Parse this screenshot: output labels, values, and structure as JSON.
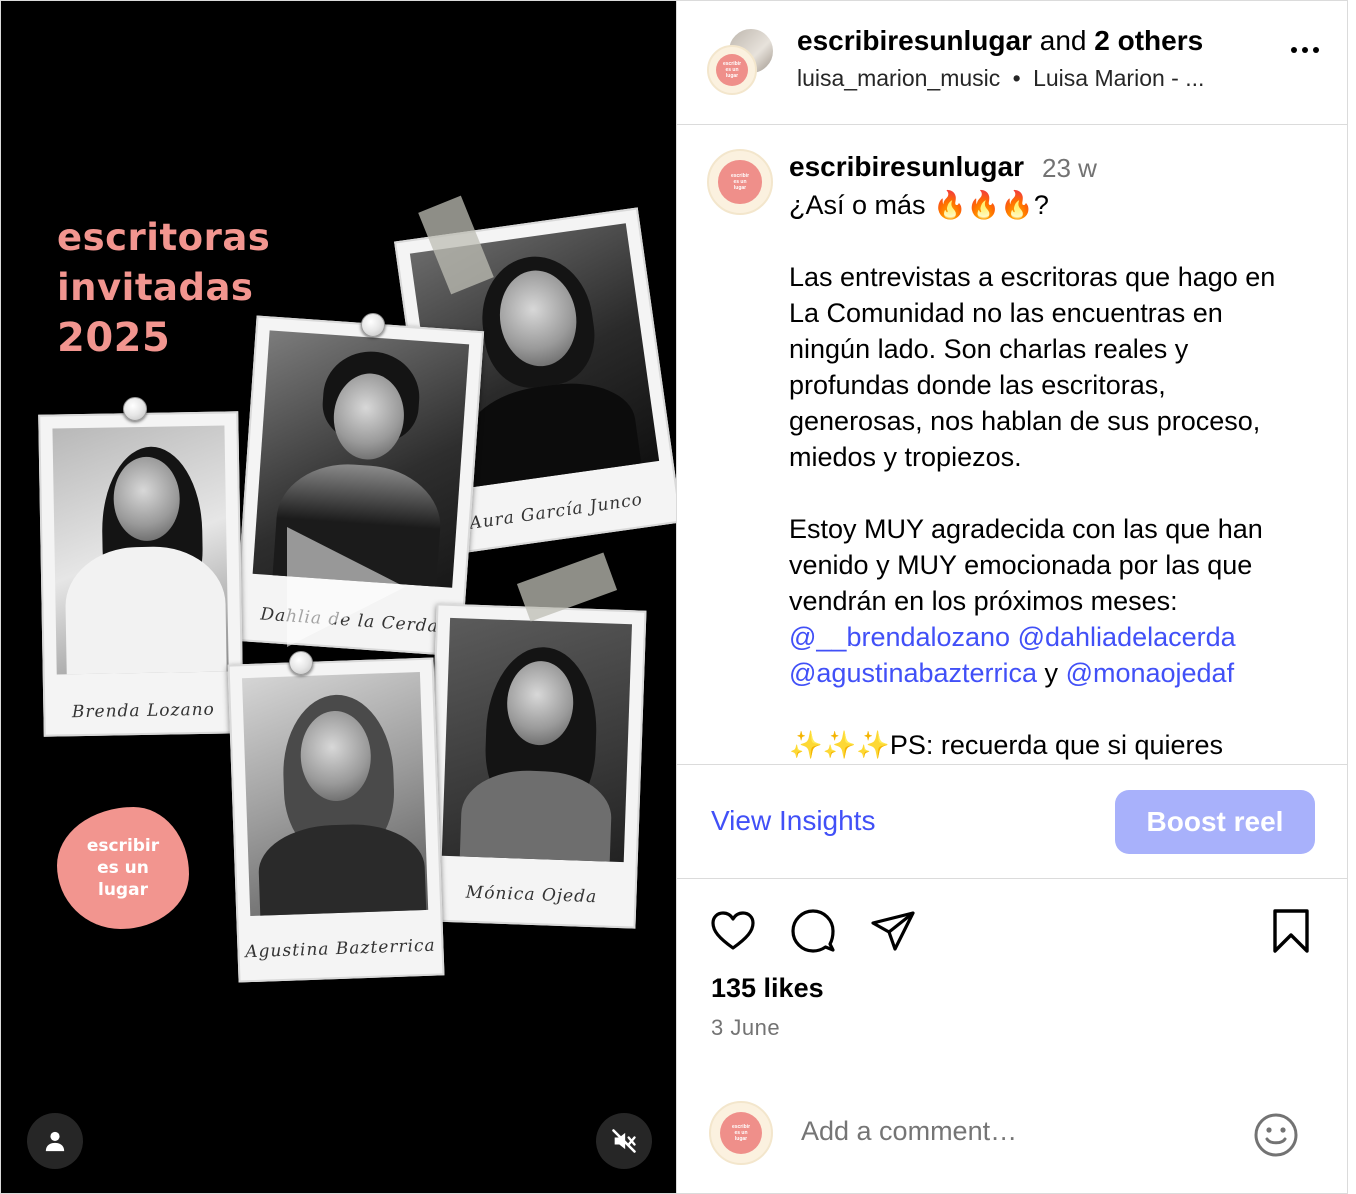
{
  "poster": {
    "title_line1": "escritoras",
    "title_line2": "invitadas",
    "year": "2025",
    "logo_text": "escribir\nes un\nlugar",
    "photos": [
      {
        "caption": "Brenda Lozano"
      },
      {
        "caption": "Dahlia de la Cerda"
      },
      {
        "caption": "Aura García Junco"
      },
      {
        "caption": "Agustina Bazterrica"
      },
      {
        "caption": "Mónica Ojeda"
      }
    ]
  },
  "media_controls": {
    "tagged_icon": "user-icon",
    "mute_icon": "muted-speaker-icon",
    "play_icon": "play-icon"
  },
  "header": {
    "author": "escribiresunlugar",
    "and_text": " and ",
    "others": "2 others",
    "audio_user": "luisa_marion_music",
    "separator": "•",
    "audio_title": "Luisa Marion - ...",
    "more_icon": "more-horizontal-icon",
    "avatar_logo_text": "escribir\nes un\nlugar"
  },
  "caption": {
    "username": "escribiresunlugar",
    "time": "23 w",
    "line1": "¿Así o más 🔥🔥🔥?",
    "para1": [
      "Las entrevistas a escritoras que hago en",
      "La Comunidad no las encuentras en",
      "ningún lado. Son charlas reales y",
      "profundas donde las escritoras,",
      "generosas, nos hablan de sus proceso,",
      "miedos y tropiezos."
    ],
    "para2": [
      "Estoy MUY agradecida con las que han",
      "venido y MUY emocionada por las que",
      "vendrán en los próximos meses:"
    ],
    "mention1": "@__brendalozano",
    "mention2": "@dahliadelacerda",
    "mention3": "@agustinabazterrica",
    "conj": " y ",
    "mention4": "@monaojedaf",
    "ps_line": "✨✨✨PS: recuerda que si quieres"
  },
  "actions": {
    "insights_label": "View Insights",
    "boost_label": "Boost reel"
  },
  "icons": {
    "like": "heart-icon",
    "comment": "comment-icon",
    "share": "send-icon",
    "save": "bookmark-icon",
    "emoji": "emoji-icon"
  },
  "likes": "135 likes",
  "date": "3 June",
  "comment": {
    "placeholder": "Add a comment…"
  },
  "colors": {
    "accent_pink": "#f2958f",
    "link_blue": "#4150f7",
    "boost_disabled": "#a8b1fb"
  }
}
